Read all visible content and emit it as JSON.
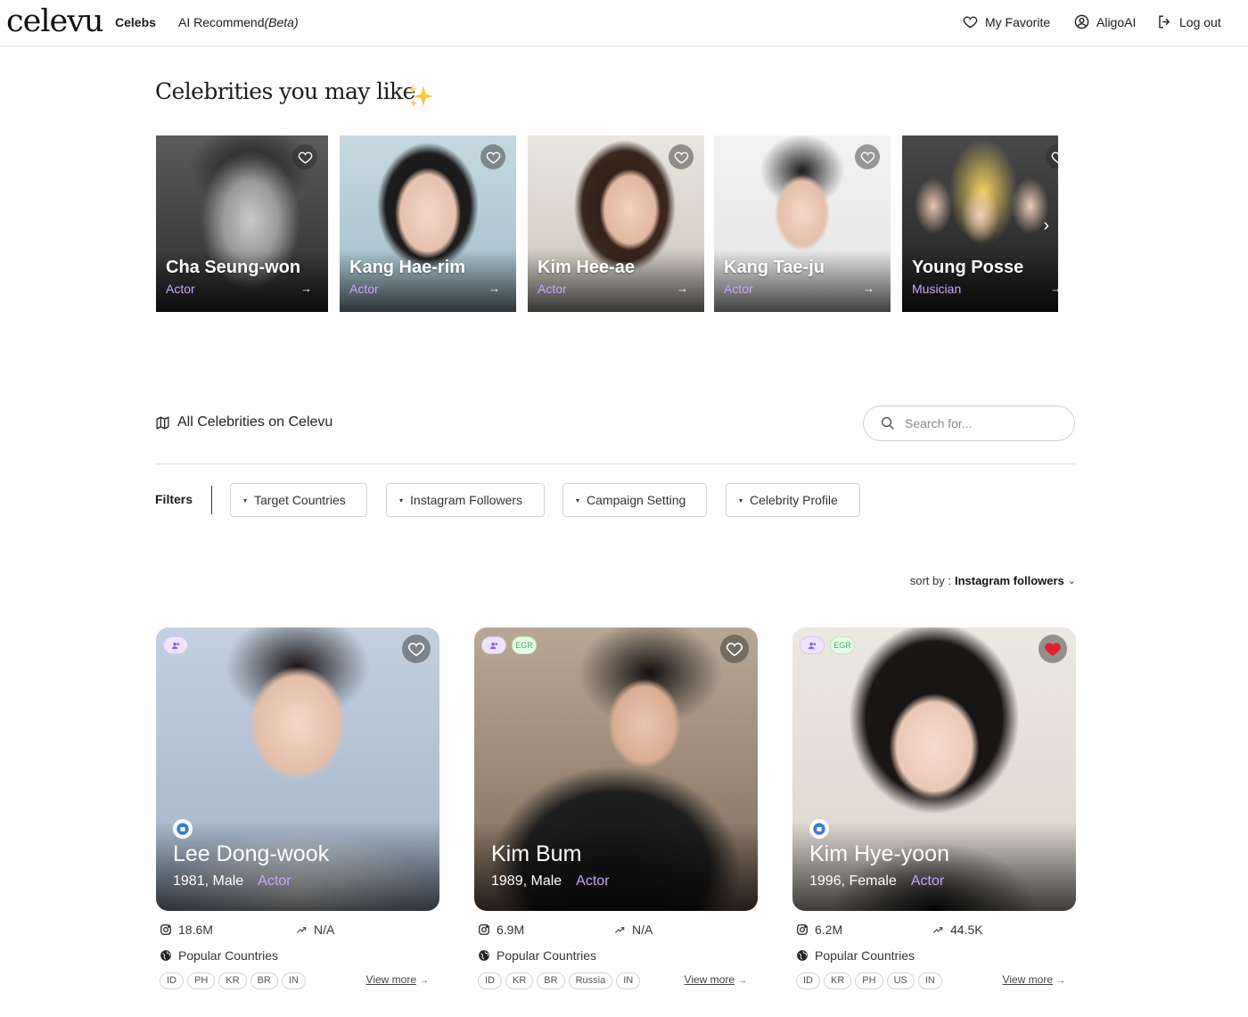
{
  "header": {
    "logo": "celevu",
    "nav": {
      "celebs": "Celebs",
      "ai_recommend": "AI Recommend",
      "ai_beta": "(Beta)"
    },
    "my_favorite": "My Favorite",
    "account": "AligoAI",
    "logout": "Log out"
  },
  "recommend": {
    "title": "Celebrities you may like",
    "cards": [
      {
        "name": "Cha Seung-won",
        "role": "Actor",
        "arrow": "→"
      },
      {
        "name": "Kang Hae-rim",
        "role": "Actor",
        "arrow": "→"
      },
      {
        "name": "Kim Hee-ae",
        "role": "Actor",
        "arrow": "→"
      },
      {
        "name": "Kang Tae-ju",
        "role": "Actor",
        "arrow": "→"
      },
      {
        "name": "Young Posse",
        "role": "Musician",
        "arrow": "→"
      }
    ]
  },
  "all": {
    "title": "All Celebrities on Celevu",
    "search_placeholder": "Search for...",
    "filters_label": "Filters",
    "filters": [
      "Target Countries",
      "Instagram Followers",
      "Campaign Setting",
      "Celebrity Profile"
    ],
    "sort_label": "sort by :",
    "sort_value": "Instagram followers"
  },
  "celebs": [
    {
      "name": "Lee Dong-wook",
      "meta": "1981, Male",
      "role": "Actor",
      "egr_badge": "",
      "followers": "18.6M",
      "engagement": "N/A",
      "popular_label": "Popular Countries",
      "countries": [
        "ID",
        "PH",
        "KR",
        "BR",
        "IN"
      ],
      "view_more": "View more",
      "favorited": false
    },
    {
      "name": "Kim Bum",
      "meta": "1989, Male",
      "role": "Actor",
      "egr_badge": "EGR",
      "followers": "6.9M",
      "engagement": "N/A",
      "popular_label": "Popular Countries",
      "countries": [
        "ID",
        "KR",
        "BR",
        "Russia",
        "IN"
      ],
      "view_more": "View more",
      "favorited": false
    },
    {
      "name": "Kim Hye-yoon",
      "meta": "1996, Female",
      "role": "Actor",
      "egr_badge": "EGR",
      "followers": "6.2M",
      "engagement": "44.5K",
      "popular_label": "Popular Countries",
      "countries": [
        "ID",
        "KR",
        "PH",
        "US",
        "IN"
      ],
      "view_more": "View more",
      "favorited": true
    }
  ],
  "colors": {
    "accent_purple": "#c8a6ff",
    "heart_red": "#e0202e",
    "egr_green": "#46b25b"
  }
}
